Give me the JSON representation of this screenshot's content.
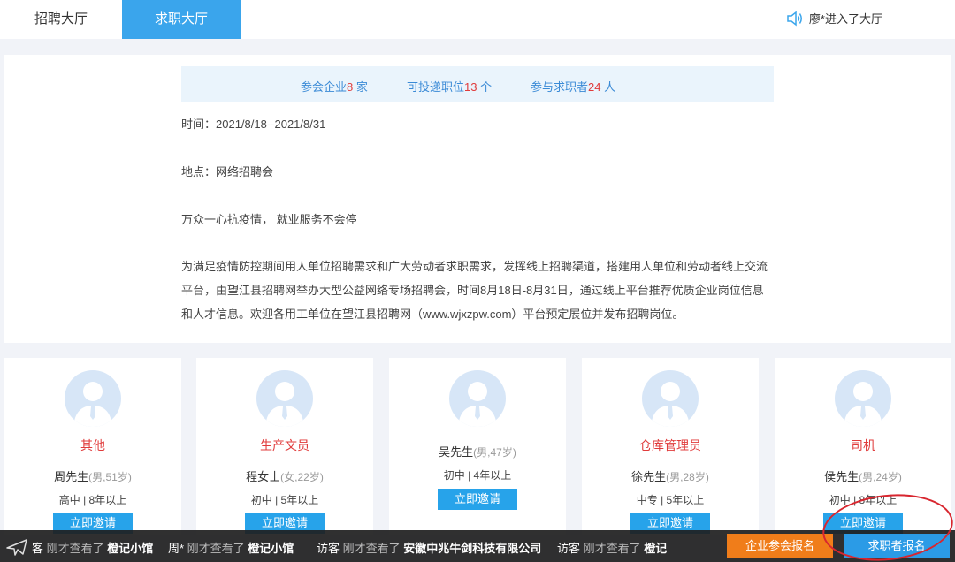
{
  "tabs": [
    {
      "label": "招聘大厅"
    },
    {
      "label": "求职大厅"
    }
  ],
  "notice": {
    "user": "廖*",
    "text": " 进入了大厅"
  },
  "stats": {
    "companies_prefix": "参会企业",
    "companies_value": "8",
    "companies_suffix": " 家",
    "positions_prefix": "可投递职位",
    "positions_value": "13",
    "positions_suffix": " 个",
    "seekers_prefix": "参与求职者",
    "seekers_value": "24",
    "seekers_suffix": " 人"
  },
  "info": {
    "time": "时间：2021/8/18--2021/8/31",
    "location": "地点：网络招聘会",
    "slogan": "万众一心抗疫情， 就业服务不会停",
    "description": "为满足疫情防控期间用人单位招聘需求和广大劳动者求职需求，发挥线上招聘渠道，搭建用人单位和劳动者线上交流平台，由望江县招聘网举办大型公益网络专场招聘会，时间8月18日-8月31日，通过线上平台推荐优质企业岗位信息和人才信息。欢迎各用工单位在望江县招聘网（www.wjxzpw.com）平台预定展位并发布招聘岗位。"
  },
  "cards": [
    {
      "title": "其他",
      "name": "周先生",
      "meta": "(男,51岁)",
      "edu": "高中 | 8年以上",
      "button": "立即邀请"
    },
    {
      "title": "生产文员",
      "name": "程女士",
      "meta": "(女,22岁)",
      "edu": "初中 | 5年以上",
      "button": "立即邀请"
    },
    {
      "title": "",
      "name": "吴先生",
      "meta": "(男,47岁)",
      "edu": "初中 | 4年以上",
      "button": "立即邀请"
    },
    {
      "title": "仓库管理员",
      "name": "徐先生",
      "meta": "(男,28岁)",
      "edu": "中专 | 5年以上",
      "button": "立即邀请"
    },
    {
      "title": "司机",
      "name": "侯先生",
      "meta": "(男,24岁)",
      "edu": "初中 | 8年以上",
      "button": "立即邀请"
    }
  ],
  "ticker": [
    {
      "who": "客",
      "act": " 刚才查看了 ",
      "target": "橙记小馆"
    },
    {
      "who": "周*",
      "act": " 刚才查看了 ",
      "target": "橙记小馆"
    },
    {
      "who": "访客",
      "act": " 刚才查看了 ",
      "target": "安徽中兆牛剑科技有限公司"
    },
    {
      "who": "访客",
      "act": " 刚才查看了 ",
      "target": "橙记"
    }
  ],
  "buttons": {
    "enterprise": "企业参会报名",
    "seeker": "求职者报名"
  }
}
